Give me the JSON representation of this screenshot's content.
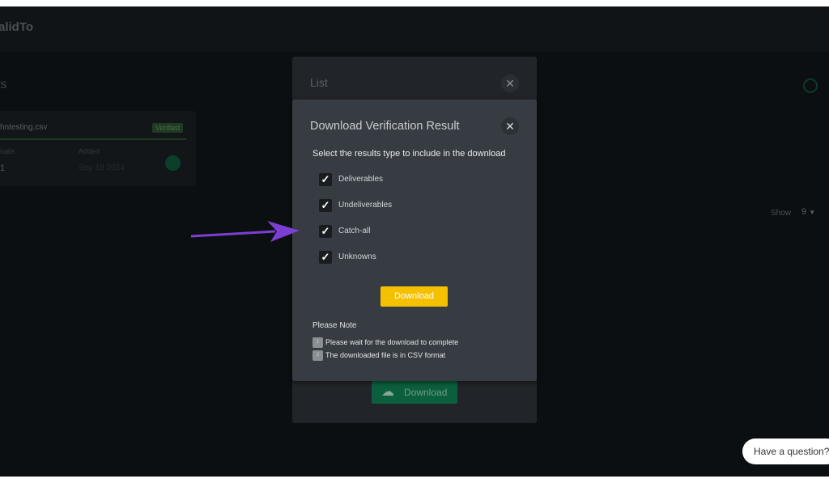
{
  "app": {
    "logo": "alidTo",
    "page_title": "ts"
  },
  "card": {
    "filename": "hntesting.csv",
    "status": "Verified",
    "emails_label": "nails",
    "emails_value": "1",
    "added_label": "Added",
    "added_value": "Sep 18 2024"
  },
  "pagination": {
    "show_label": "Show",
    "show_value": "9"
  },
  "list_modal": {
    "title": "List",
    "download_label": "Download"
  },
  "dialog": {
    "title": "Download Verification Result",
    "subtitle": "Select the results type to include in the download",
    "options": [
      {
        "label": "Deliverables",
        "checked": true
      },
      {
        "label": "Undeliverables",
        "checked": true
      },
      {
        "label": "Catch-all",
        "checked": true
      },
      {
        "label": "Unknowns",
        "checked": true
      }
    ],
    "download_label": "Download",
    "note_title": "Please Note",
    "notes": [
      {
        "n": "1",
        "text": "Please wait for the download to complete"
      },
      {
        "n": "2",
        "text": "The downloaded file is in CSV format"
      }
    ]
  },
  "chat": {
    "label": "Have a question?"
  },
  "colors": {
    "accent": "#f5c000",
    "arrow": "#7b3fd1",
    "green": "#0b5f3c"
  }
}
